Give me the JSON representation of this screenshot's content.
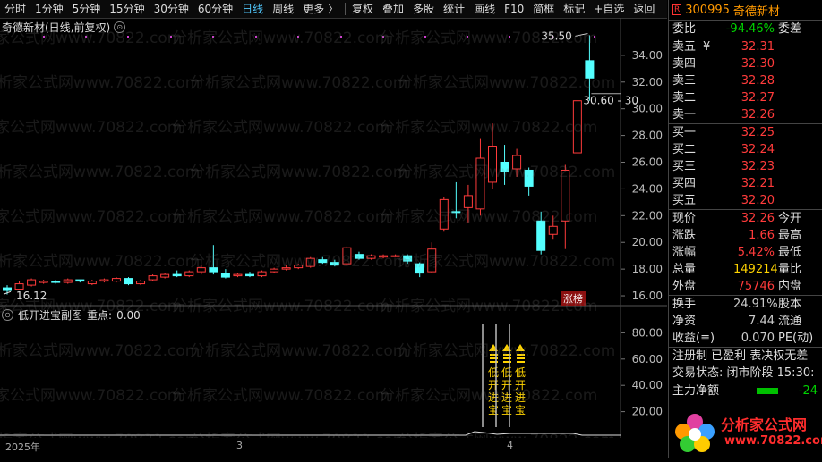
{
  "toolbar": {
    "left_items": [
      "分时",
      "1分钟",
      "5分钟",
      "15分钟",
      "30分钟",
      "60分钟",
      "日线",
      "周线",
      "更多 〉"
    ],
    "active": "日线",
    "right_items": [
      "复权",
      "叠加",
      "多股",
      "统计",
      "画线",
      "F10",
      "简框",
      "标记",
      "+自选",
      "返回"
    ]
  },
  "main_header": {
    "title": "奇德新材(日线,前复权)",
    "circ": "⊙"
  },
  "watermark": "分析家公式网www.70822.com",
  "price_axis": {
    "ticks": [
      "16.00",
      "18.00",
      "20.00",
      "22.00",
      "24.00",
      "26.00",
      "28.00",
      "30.00",
      "32.00",
      "34.00"
    ]
  },
  "chart_data": {
    "type": "candlestick",
    "title": "奇德新材(日线,前复权)",
    "ylim": [
      15.2,
      36.8
    ],
    "candles": [
      {
        "o": 16.4,
        "c": 16.6,
        "h": 16.8,
        "l": 16.1,
        "up": false
      },
      {
        "o": 16.5,
        "c": 16.9,
        "h": 17.1,
        "l": 16.4,
        "up": true
      },
      {
        "o": 16.8,
        "c": 17.2,
        "h": 17.3,
        "l": 16.7,
        "up": true
      },
      {
        "o": 17.0,
        "c": 17.1,
        "h": 17.2,
        "l": 16.9,
        "up": true
      },
      {
        "o": 17.1,
        "c": 17.0,
        "h": 17.2,
        "l": 16.9,
        "up": false
      },
      {
        "o": 17.0,
        "c": 17.2,
        "h": 17.3,
        "l": 16.9,
        "up": true
      },
      {
        "o": 17.2,
        "c": 17.1,
        "h": 17.2,
        "l": 17.0,
        "up": false
      },
      {
        "o": 16.9,
        "c": 17.1,
        "h": 17.2,
        "l": 16.8,
        "up": true
      },
      {
        "o": 17.1,
        "c": 17.2,
        "h": 17.3,
        "l": 17.0,
        "up": true
      },
      {
        "o": 17.1,
        "c": 17.3,
        "h": 17.4,
        "l": 17.0,
        "up": true
      },
      {
        "o": 17.3,
        "c": 16.9,
        "h": 17.4,
        "l": 16.8,
        "up": false
      },
      {
        "o": 16.9,
        "c": 17.1,
        "h": 17.2,
        "l": 16.8,
        "up": true
      },
      {
        "o": 17.2,
        "c": 17.5,
        "h": 17.6,
        "l": 17.1,
        "up": true
      },
      {
        "o": 17.4,
        "c": 17.6,
        "h": 17.7,
        "l": 17.3,
        "up": true
      },
      {
        "o": 17.6,
        "c": 17.5,
        "h": 17.9,
        "l": 17.4,
        "up": false
      },
      {
        "o": 17.5,
        "c": 17.8,
        "h": 17.9,
        "l": 17.4,
        "up": true
      },
      {
        "o": 17.8,
        "c": 18.1,
        "h": 18.3,
        "l": 17.6,
        "up": true
      },
      {
        "o": 18.1,
        "c": 17.8,
        "h": 19.8,
        "l": 17.6,
        "up": false
      },
      {
        "o": 17.7,
        "c": 17.4,
        "h": 18.0,
        "l": 17.3,
        "up": false
      },
      {
        "o": 17.5,
        "c": 17.6,
        "h": 17.7,
        "l": 17.4,
        "up": true
      },
      {
        "o": 17.6,
        "c": 17.5,
        "h": 17.8,
        "l": 17.4,
        "up": false
      },
      {
        "o": 17.5,
        "c": 17.8,
        "h": 17.9,
        "l": 17.4,
        "up": true
      },
      {
        "o": 17.8,
        "c": 18.0,
        "h": 18.1,
        "l": 17.7,
        "up": true
      },
      {
        "o": 18.0,
        "c": 18.1,
        "h": 18.3,
        "l": 17.9,
        "up": true
      },
      {
        "o": 18.1,
        "c": 18.3,
        "h": 18.4,
        "l": 18.0,
        "up": true
      },
      {
        "o": 18.2,
        "c": 18.8,
        "h": 18.9,
        "l": 18.1,
        "up": true
      },
      {
        "o": 18.7,
        "c": 18.5,
        "h": 18.9,
        "l": 18.4,
        "up": false
      },
      {
        "o": 18.5,
        "c": 18.3,
        "h": 18.7,
        "l": 18.2,
        "up": false
      },
      {
        "o": 18.4,
        "c": 19.6,
        "h": 19.7,
        "l": 18.3,
        "up": true
      },
      {
        "o": 19.1,
        "c": 18.8,
        "h": 19.3,
        "l": 18.7,
        "up": false
      },
      {
        "o": 18.8,
        "c": 19.0,
        "h": 19.1,
        "l": 18.7,
        "up": true
      },
      {
        "o": 18.9,
        "c": 19.0,
        "h": 19.1,
        "l": 18.8,
        "up": true
      },
      {
        "o": 19.0,
        "c": 19.0,
        "h": 19.1,
        "l": 18.9,
        "up": true
      },
      {
        "o": 19.0,
        "c": 18.6,
        "h": 19.1,
        "l": 18.4,
        "up": false
      },
      {
        "o": 18.4,
        "c": 17.7,
        "h": 18.5,
        "l": 17.4,
        "up": false
      },
      {
        "o": 17.8,
        "c": 19.5,
        "h": 20.0,
        "l": 17.7,
        "up": true
      },
      {
        "o": 21.0,
        "c": 23.2,
        "h": 23.4,
        "l": 20.8,
        "up": true
      },
      {
        "o": 22.3,
        "c": 22.3,
        "h": 24.5,
        "l": 21.8,
        "up": false
      },
      {
        "o": 22.6,
        "c": 23.5,
        "h": 24.3,
        "l": 21.5,
        "up": true
      },
      {
        "o": 22.5,
        "c": 26.3,
        "h": 27.8,
        "l": 22.0,
        "up": true
      },
      {
        "o": 24.5,
        "c": 27.2,
        "h": 28.9,
        "l": 24.0,
        "up": true
      },
      {
        "o": 26.0,
        "c": 25.3,
        "h": 27.3,
        "l": 24.3,
        "up": false
      },
      {
        "o": 25.5,
        "c": 26.5,
        "h": 27.0,
        "l": 24.9,
        "up": true
      },
      {
        "o": 25.4,
        "c": 24.2,
        "h": 25.6,
        "l": 23.5,
        "up": false
      },
      {
        "o": 21.6,
        "c": 19.4,
        "h": 22.3,
        "l": 19.1,
        "up": false
      },
      {
        "o": 20.6,
        "c": 21.2,
        "h": 22.0,
        "l": 20.2,
        "up": true
      },
      {
        "o": 21.6,
        "c": 25.4,
        "h": 25.8,
        "l": 19.5,
        "up": true
      },
      {
        "o": 26.7,
        "c": 30.6,
        "h": 30.6,
        "l": 26.7,
        "up": true
      },
      {
        "o": 32.3,
        "c": 33.6,
        "h": 35.5,
        "l": 30.6,
        "up": false
      }
    ]
  },
  "annotations": {
    "high_label": "35.50",
    "low_label": "16.12",
    "mid_label": "30.60 - 30",
    "badge": "涨榜"
  },
  "sub_header": {
    "circ": "⊙",
    "title": "低开进宝副图",
    "focus_label": "重点:",
    "focus_value": "0.00"
  },
  "ind_axis": {
    "ticks": [
      "80.00",
      "60.00",
      "40.00",
      "20.00"
    ]
  },
  "signal_text": [
    "低",
    "开",
    "进",
    "宝"
  ],
  "date_axis": {
    "labels": [
      "2025年",
      "3",
      "4"
    ]
  },
  "panel": {
    "r_icon": "R",
    "code": "300995",
    "name": "奇德新材",
    "webi": {
      "label": "委比",
      "value": "-94.46%",
      "label2": "委差"
    },
    "asks": [
      {
        "label": "卖五",
        "mark": "¥",
        "price": "32.31"
      },
      {
        "label": "卖四",
        "mark": "",
        "price": "32.30"
      },
      {
        "label": "卖三",
        "mark": "",
        "price": "32.28"
      },
      {
        "label": "卖二",
        "mark": "",
        "price": "32.27"
      },
      {
        "label": "卖一",
        "mark": "",
        "price": "32.26"
      }
    ],
    "bids": [
      {
        "label": "买一",
        "price": "32.25"
      },
      {
        "label": "买二",
        "price": "32.24"
      },
      {
        "label": "买三",
        "price": "32.23"
      },
      {
        "label": "买四",
        "price": "32.21"
      },
      {
        "label": "买五",
        "price": "32.20"
      }
    ],
    "quote": [
      {
        "label": "现价",
        "value": "32.26",
        "label2": "今开",
        "color": "red"
      },
      {
        "label": "涨跌",
        "value": "1.66",
        "label2": "最高",
        "color": "red"
      },
      {
        "label": "涨幅",
        "value": "5.42%",
        "label2": "最低",
        "color": "red"
      },
      {
        "label": "总量",
        "value": "149214",
        "label2": "量比",
        "color": "yellow"
      },
      {
        "label": "外盘",
        "value": "75746",
        "label2": "内盘",
        "color": "red"
      }
    ],
    "stats": [
      {
        "label": "换手",
        "value": "24.91%",
        "label2": "股本"
      },
      {
        "label": "净资",
        "value": "7.44",
        "label2": "流通"
      },
      {
        "label": "收益(≡)",
        "value": "0.070",
        "label2": "PE(动)"
      }
    ],
    "reg_line": "注册制 已盈利 表决权无差",
    "trade_status": "交易状态: 闭市阶段 15:30:",
    "net_flow": {
      "label": "主力净额",
      "value": "-24"
    },
    "logo_text1": "分析家公式网",
    "logo_text2": "www.70822.com"
  }
}
